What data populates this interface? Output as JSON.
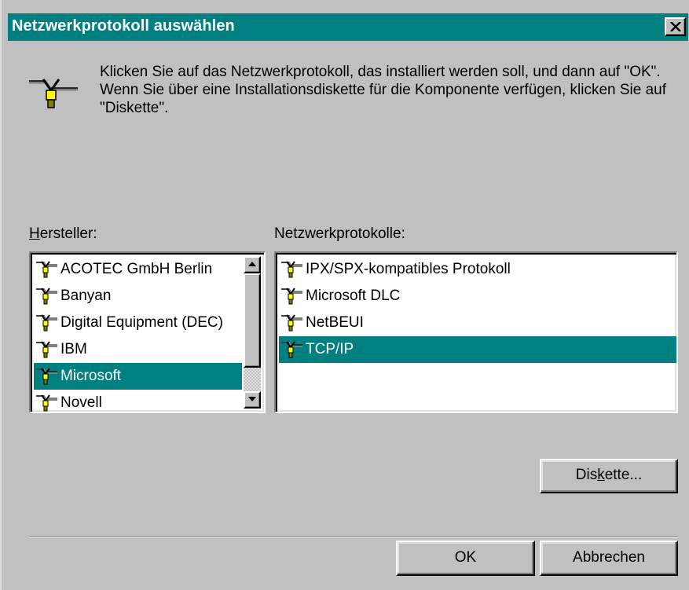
{
  "dialog": {
    "title": "Netzwerkprotokoll auswählen",
    "intro_text": "Klicken Sie auf das Netzwerkprotokoll, das installiert werden soll, und dann auf \"OK\". Wenn Sie über eine Installationsdiskette für die Komponente verfügen, klicken Sie auf \"Diskette\"."
  },
  "manufacturers": {
    "label_prefix": "",
    "label_accel": "H",
    "label_rest": "ersteller:",
    "items": [
      {
        "label": "ACOTEC GmbH Berlin",
        "selected": false
      },
      {
        "label": "Banyan",
        "selected": false
      },
      {
        "label": "Digital Equipment (DEC)",
        "selected": false
      },
      {
        "label": "IBM",
        "selected": false
      },
      {
        "label": "Microsoft",
        "selected": true
      },
      {
        "label": "Novell",
        "selected": false
      }
    ]
  },
  "protocols": {
    "label": "Netzwerkprotokolle:",
    "items": [
      {
        "label": "IPX/SPX-kompatibles Protokoll",
        "selected": false
      },
      {
        "label": "Microsoft DLC",
        "selected": false
      },
      {
        "label": "NetBEUI",
        "selected": false
      },
      {
        "label": "TCP/IP",
        "selected": true
      }
    ]
  },
  "buttons": {
    "diskette_prefix": "Dis",
    "diskette_accel": "k",
    "diskette_rest": "ette...",
    "ok": "OK",
    "cancel": "Abbrechen"
  },
  "icons": {
    "close": "close-icon",
    "protocol": "network-protocol-icon",
    "scroll_up": "arrow-up-icon",
    "scroll_down": "arrow-down-icon"
  },
  "colors": {
    "titlebar": "#008080",
    "selection": "#008080",
    "face": "#c0c0c0"
  }
}
